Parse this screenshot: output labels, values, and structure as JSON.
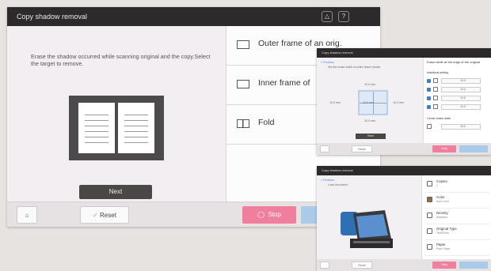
{
  "main": {
    "title": "Copy shadow removal",
    "instruction": "Erase the shadow occurred while scanning original and the copy.Select the target to remove.",
    "next_label": "Next",
    "options": [
      {
        "label": "Outer frame of an orig.",
        "icon": "outer-frame-icon"
      },
      {
        "label": "Inner frame of",
        "icon": "inner-frame-icon"
      },
      {
        "label": "Fold",
        "icon": "fold-icon"
      }
    ],
    "footer": {
      "home_icon": "home-icon",
      "reset_label": "Reset",
      "stop_label": "Stop"
    },
    "colors": {
      "titlebar": "#2d2a2b",
      "stop": "#ef7f9d",
      "start": "#a9cbe9"
    }
  },
  "screen2": {
    "title": "Copy shadow removal",
    "back_label": "< Previous",
    "hint": "Set the erase width of entire frame border.",
    "dims": {
      "top": "10.0 mm",
      "left": "10.0 mm",
      "center": "10.0 mm",
      "right": "10.0 mm",
      "bottom": "10.0 mm"
    },
    "next_label": "Next",
    "panel_title": "Erase width at the edge of the original",
    "individual_setting": "Individual setting",
    "field_value": "10.0",
    "unit": "mm",
    "center_erase": "Center erase width",
    "stop_label": "Stop",
    "reset_label": "Reset"
  },
  "screen3": {
    "title": "Copy shadow removal",
    "back_label": "< Previous",
    "hint": "Load document.",
    "items": [
      {
        "title": "Copies",
        "sub": "1"
      },
      {
        "title": "Color",
        "sub": "Auto Color"
      },
      {
        "title": "Density",
        "sub": "Standard"
      },
      {
        "title": "Original Type",
        "sub": "Text/Photo"
      },
      {
        "title": "Paper",
        "sub": "Plain Paper"
      }
    ],
    "stop_label": "Stop",
    "reset_label": "Reset"
  }
}
